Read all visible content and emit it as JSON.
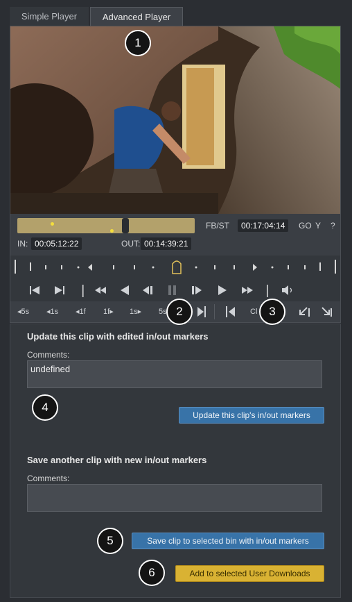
{
  "tabs": {
    "simple": "Simple Player",
    "advanced": "Advanced Player"
  },
  "player": {
    "fbst_label": "FB/ST",
    "current_tc": "00:17:04:14",
    "go_label": "GO",
    "y_label": "Y",
    "help_label": "?",
    "in_label": "IN:",
    "in_tc": "00:05:12:22",
    "out_label": "OUT:",
    "out_tc": "00:14:39:21"
  },
  "steps": {
    "back5": "5s",
    "back1": "1s",
    "back1f": "1f",
    "fwd1f": "1f",
    "fwd1": "1s",
    "fwd5": "5s",
    "clip_partial": "Cl"
  },
  "update_section": {
    "title": "Update this clip with edited in/out markers",
    "comments_label": "Comments:",
    "comments_value": "undefined",
    "button": "Update this clip's in/out markers"
  },
  "save_section": {
    "title": "Save another clip with new in/out markers",
    "comments_label": "Comments:",
    "comments_value": "",
    "save_button": "Save clip to selected bin with in/out markers",
    "download_button": "Add to selected User Downloads"
  },
  "callouts": [
    "1",
    "2",
    "3",
    "4",
    "5",
    "6"
  ]
}
